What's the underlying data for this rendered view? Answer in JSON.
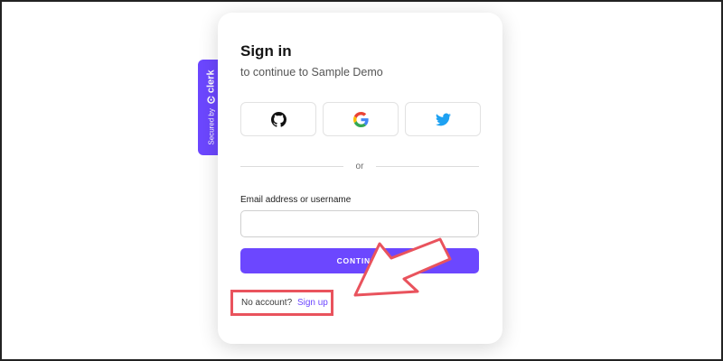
{
  "badge": {
    "secured_label": "Secured by",
    "brand_label": "clerk"
  },
  "card": {
    "title": "Sign in",
    "subtitle": "to continue to Sample Demo",
    "social_buttons": [
      {
        "provider": "GitHub",
        "icon": "github-icon"
      },
      {
        "provider": "Google",
        "icon": "google-icon"
      },
      {
        "provider": "Twitter",
        "icon": "twitter-icon"
      }
    ],
    "divider_text": "or",
    "email_label": "Email address or username",
    "email_value": "",
    "continue_label": "CONTINUE",
    "no_account_text": "No account?",
    "signup_label": "Sign up"
  },
  "colors": {
    "accent": "#6c47ff",
    "highlight": "#e9535d",
    "google_blue": "#4285F4",
    "google_red": "#EA4335",
    "google_yellow": "#FBBC05",
    "google_green": "#34A853",
    "twitter_blue": "#1DA1F2"
  }
}
